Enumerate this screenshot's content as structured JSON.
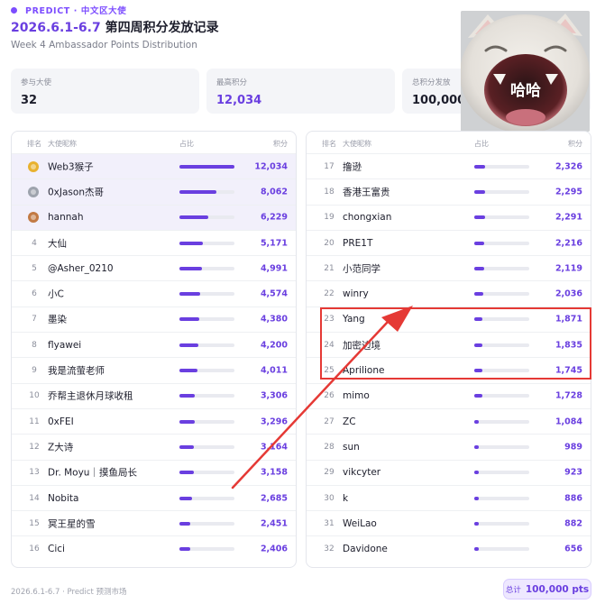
{
  "header": {
    "eyebrow": "PREDICT · 中文区大使",
    "title_date": "2026.6.1-6.7",
    "title_text": " 第四周积分发放记录",
    "subtitle": "Week 4 Ambassador Points Distribution"
  },
  "stats": [
    {
      "label": "参与大使",
      "value": "32"
    },
    {
      "label": "最高积分",
      "value": "12,034"
    },
    {
      "label": "总积分发放",
      "value": "100,000"
    }
  ],
  "meme": {
    "caption": "哈哈"
  },
  "table_headers": {
    "rank": "排名",
    "name": "大使昵称",
    "ratio": "占比",
    "points": "积分"
  },
  "max_points": 12034,
  "left_rows": [
    {
      "rank": "1",
      "name": "Web3猴子",
      "points": "12,034",
      "value": 12034,
      "medal": "gold"
    },
    {
      "rank": "2",
      "name": "0xJason杰哥",
      "points": "8,062",
      "value": 8062,
      "medal": "silver"
    },
    {
      "rank": "3",
      "name": "hannah",
      "points": "6,229",
      "value": 6229,
      "medal": "bronze"
    },
    {
      "rank": "4",
      "name": "大仙",
      "points": "5,171",
      "value": 5171
    },
    {
      "rank": "5",
      "name": "@Asher_0210",
      "points": "4,991",
      "value": 4991
    },
    {
      "rank": "6",
      "name": "小C",
      "points": "4,574",
      "value": 4574
    },
    {
      "rank": "7",
      "name": "墨染",
      "points": "4,380",
      "value": 4380
    },
    {
      "rank": "8",
      "name": "flyawei",
      "points": "4,200",
      "value": 4200
    },
    {
      "rank": "9",
      "name": "我是流萤老师",
      "points": "4,011",
      "value": 4011
    },
    {
      "rank": "10",
      "name": "乔帮主退休月球收租",
      "points": "3,306",
      "value": 3306
    },
    {
      "rank": "11",
      "name": "0xFEI",
      "points": "3,296",
      "value": 3296
    },
    {
      "rank": "12",
      "name": "Z大诗",
      "points": "3,164",
      "value": 3164
    },
    {
      "rank": "13",
      "name": "Dr. Moyu｜摸鱼局长",
      "points": "3,158",
      "value": 3158
    },
    {
      "rank": "14",
      "name": "Nobita",
      "points": "2,685",
      "value": 2685
    },
    {
      "rank": "15",
      "name": "冥王星的雪",
      "points": "2,451",
      "value": 2451
    },
    {
      "rank": "16",
      "name": "Cici",
      "points": "2,406",
      "value": 2406
    }
  ],
  "right_rows": [
    {
      "rank": "17",
      "name": "撸逊",
      "points": "2,326",
      "value": 2326
    },
    {
      "rank": "18",
      "name": "香港王富贵",
      "points": "2,295",
      "value": 2295
    },
    {
      "rank": "19",
      "name": "chongxian",
      "points": "2,291",
      "value": 2291
    },
    {
      "rank": "20",
      "name": "PRE1T",
      "points": "2,216",
      "value": 2216
    },
    {
      "rank": "21",
      "name": "小范同学",
      "points": "2,119",
      "value": 2119
    },
    {
      "rank": "22",
      "name": "winry",
      "points": "2,036",
      "value": 2036
    },
    {
      "rank": "23",
      "name": "Yang",
      "points": "1,871",
      "value": 1871
    },
    {
      "rank": "24",
      "name": "加密边境",
      "points": "1,835",
      "value": 1835
    },
    {
      "rank": "25",
      "name": "Aprilione",
      "points": "1,745",
      "value": 1745
    },
    {
      "rank": "26",
      "name": "mimo",
      "points": "1,728",
      "value": 1728
    },
    {
      "rank": "27",
      "name": "ZC",
      "points": "1,084",
      "value": 1084
    },
    {
      "rank": "28",
      "name": "sun",
      "points": "989",
      "value": 989
    },
    {
      "rank": "29",
      "name": "vikcyter",
      "points": "923",
      "value": 923
    },
    {
      "rank": "30",
      "name": "k",
      "points": "886",
      "value": 886
    },
    {
      "rank": "31",
      "name": "WeiLao",
      "points": "882",
      "value": 882
    },
    {
      "rank": "32",
      "name": "Davidone",
      "points": "656",
      "value": 656
    }
  ],
  "footer": {
    "text": "2026.6.1-6.7 · Predict 预测市场",
    "total_label": "总计",
    "total_value": "100,000 pts"
  },
  "colors": {
    "accent": "#6a3fe0",
    "annotation": "#e53935"
  }
}
